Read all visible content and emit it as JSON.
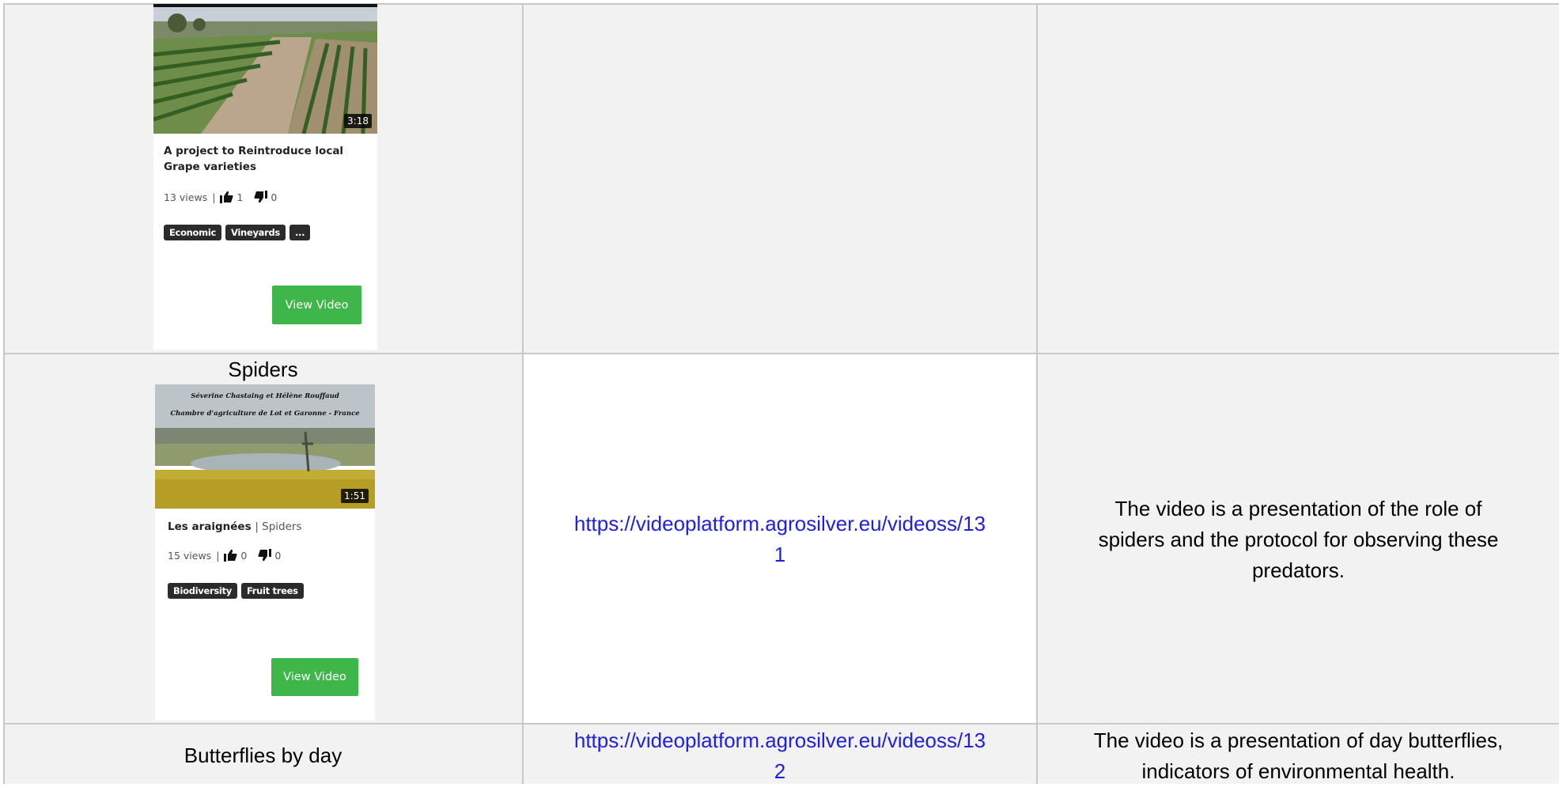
{
  "rows": [
    {
      "label": "",
      "video": {
        "title": "A project to Reintroduce local Grape varieties",
        "subtitle": "",
        "duration": "3:18",
        "views": "13 views",
        "likes": "1",
        "dislikes": "0",
        "tags": [
          "Economic",
          "Vineyards",
          "..."
        ],
        "button": "View Video"
      },
      "link": "",
      "description": ""
    },
    {
      "label": "Spiders",
      "video": {
        "thumb_caption_1": "Séverine Chastaing et Hélène Rouffaud",
        "thumb_caption_2": "Chambre d'agriculture de Lot et Garonne - France",
        "title": "Les araignées",
        "subtitle": "| Spiders",
        "duration": "1:51",
        "views": "15 views",
        "likes": "0",
        "dislikes": "0",
        "tags": [
          "Biodiversity",
          "Fruit trees"
        ],
        "button": "View Video"
      },
      "link_line1": "https://videoplatform.agrosilver.eu/videoss/13",
      "link_line2": "1",
      "description_lines": [
        "The video is a presentation of the role of",
        "spiders and the protocol for observing these",
        "predators."
      ]
    },
    {
      "label": "Butterflies by day",
      "link_line1": "https://videoplatform.agrosilver.eu/videoss/13",
      "link_line2": "2",
      "description_lines": [
        "The video is a presentation of day butterflies,",
        "indicators of environmental health."
      ]
    }
  ],
  "colors": {
    "cell_shade": "#f2f2f2",
    "border": "#c8c8c8",
    "link": "#1f1fe0",
    "button": "#3fb64a",
    "tag": "#2b2b2b"
  }
}
